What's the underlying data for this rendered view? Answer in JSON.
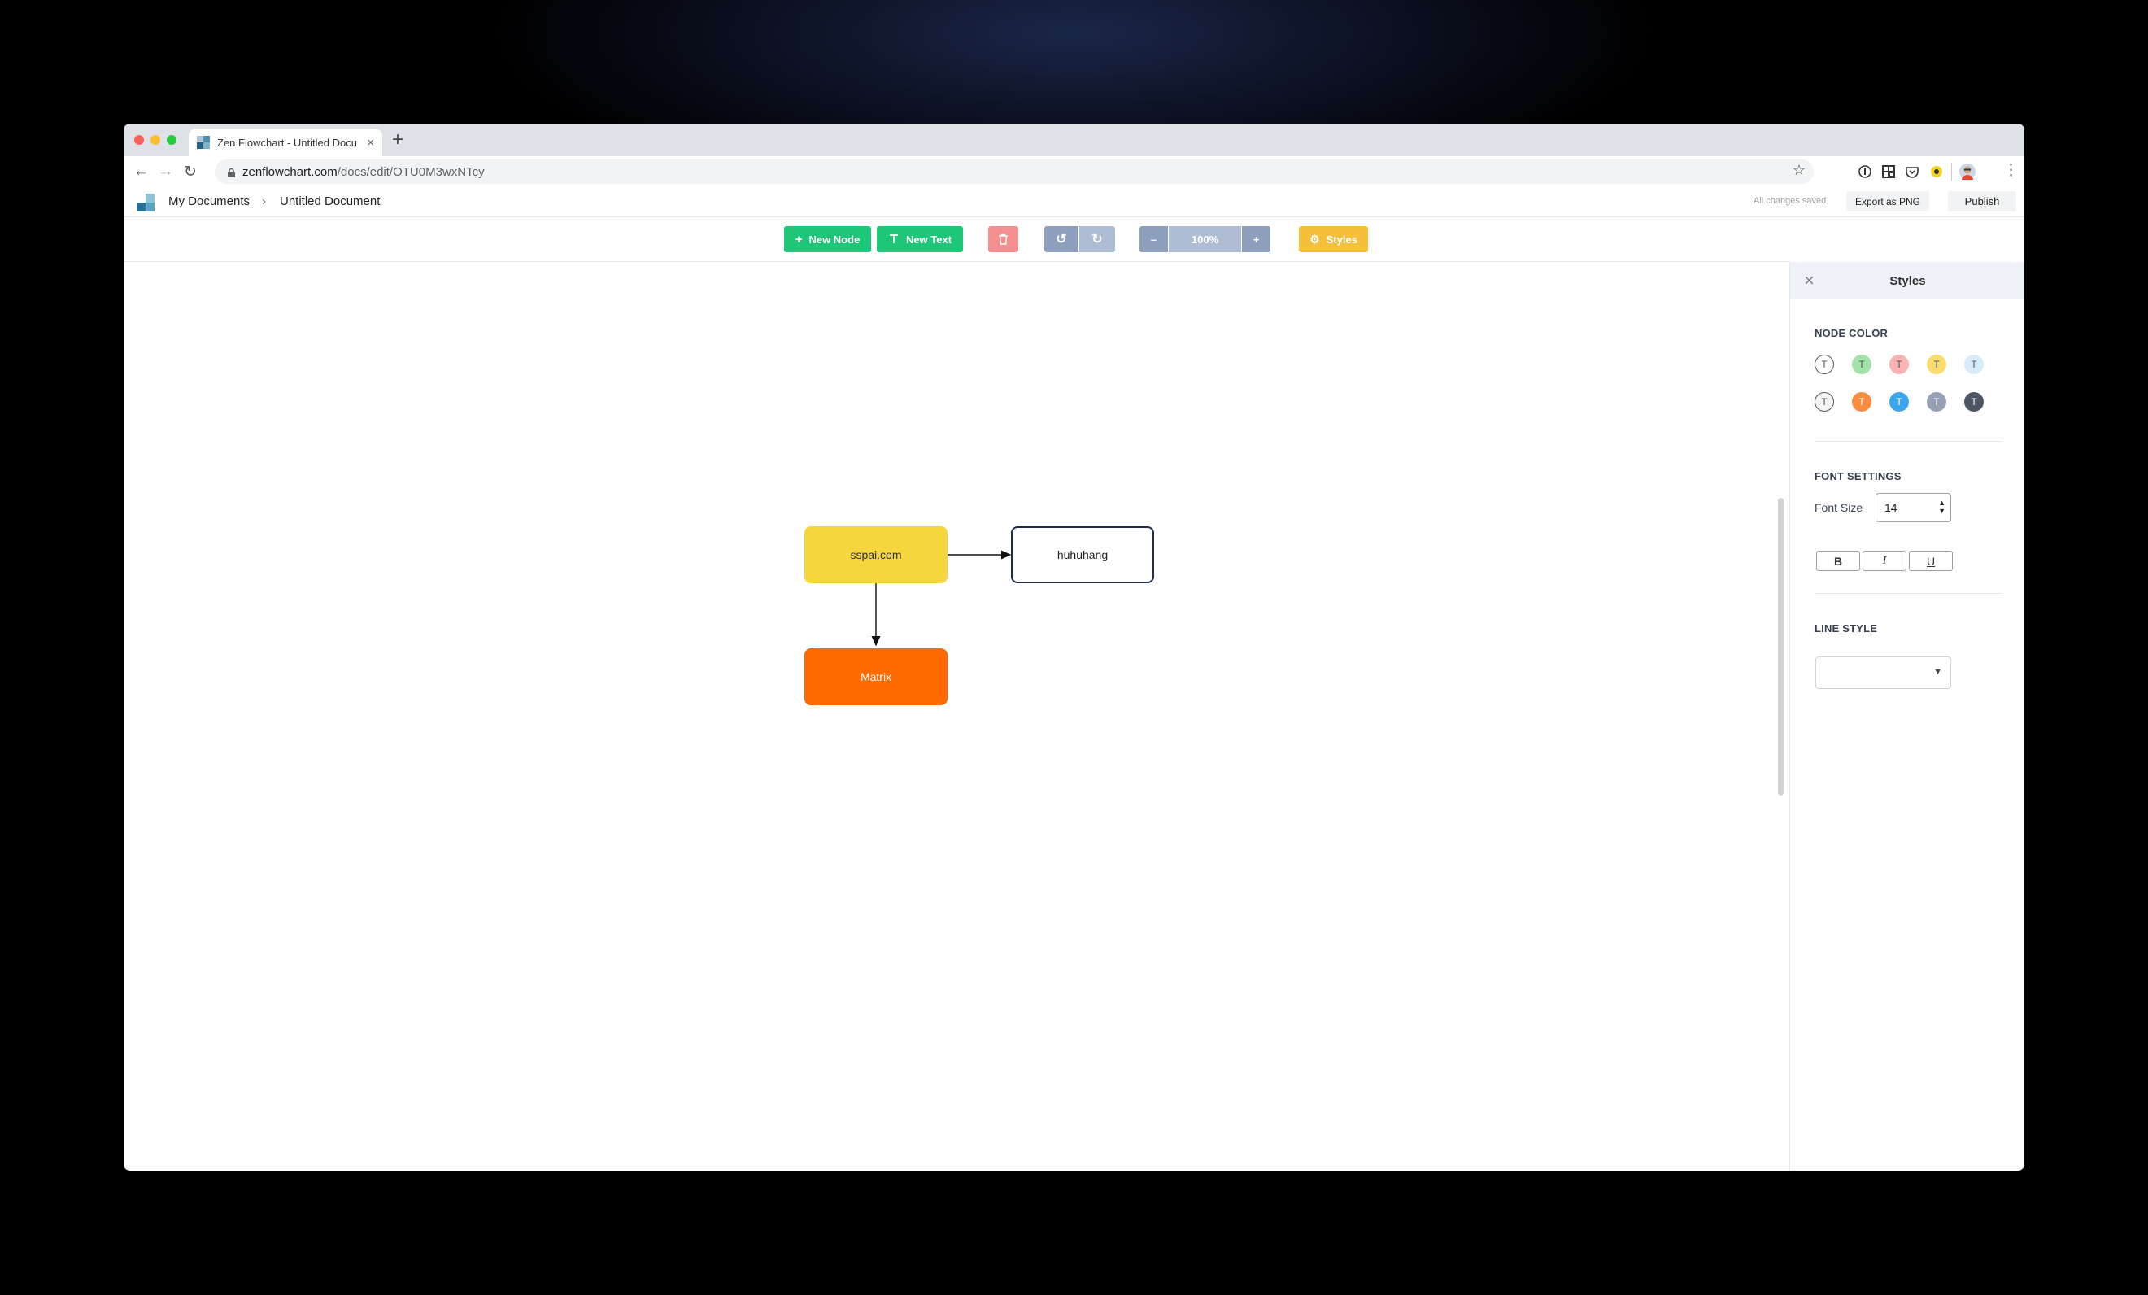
{
  "browser": {
    "tab_title": "Zen Flowchart - Untitled Docu",
    "tab_close": "×",
    "new_tab": "+",
    "url_host": "zenflowchart.com",
    "url_path": "/docs/edit/OTU0M3wxNTcy"
  },
  "header": {
    "breadcrumb_root": "My Documents",
    "breadcrumb_sep": "›",
    "breadcrumb_current": "Untitled Document",
    "save_status": "All changes saved.",
    "export_label": "Export as PNG",
    "publish_label": "Publish"
  },
  "toolbar": {
    "new_node_label": "New Node",
    "new_text_label": "New Text",
    "zoom_level": "100%",
    "zoom_out": "–",
    "zoom_in": "+",
    "styles_label": "Styles"
  },
  "canvas": {
    "nodes": [
      {
        "label": "sspai.com",
        "fill": "#f5d63d",
        "text_color": "#333333"
      },
      {
        "label": "huhuhang",
        "fill": "#ffffff",
        "border": "#1f2d4a",
        "text_color": "#222222"
      },
      {
        "label": "Matrix",
        "fill": "#ff6a00",
        "text_color": "#ffffff"
      }
    ]
  },
  "panel": {
    "title": "Styles",
    "close": "×",
    "node_color_title": "NODE COLOR",
    "swatch_glyph": "T",
    "swatches": [
      {
        "fill": "#ffffff",
        "border": "#555555",
        "text": "#555555"
      },
      {
        "fill": "#a3e3a9",
        "border": "#a3e3a9",
        "text": "#555555"
      },
      {
        "fill": "#f9b3b3",
        "border": "#f9b3b3",
        "text": "#555555"
      },
      {
        "fill": "#f7dc6f",
        "border": "#f7dc6f",
        "text": "#555555"
      },
      {
        "fill": "#d6ecfb",
        "border": "#d6ecfb",
        "text": "#555555"
      },
      {
        "fill": "#f3f4f6",
        "border": "#555555",
        "text": "#555555"
      },
      {
        "fill": "#f98c3f",
        "border": "#f98c3f",
        "text": "#ffffff"
      },
      {
        "fill": "#3aa7ec",
        "border": "#3aa7ec",
        "text": "#ffffff"
      },
      {
        "fill": "#95a0b4",
        "border": "#95a0b4",
        "text": "#ffffff"
      },
      {
        "fill": "#4b5563",
        "border": "#4b5563",
        "text": "#ffffff"
      }
    ],
    "font_settings_title": "FONT SETTINGS",
    "font_size_label": "Font Size",
    "font_size_value": "14",
    "bold_label": "B",
    "italic_label": "I",
    "underline_label": "U",
    "line_style_title": "LINE STYLE"
  }
}
